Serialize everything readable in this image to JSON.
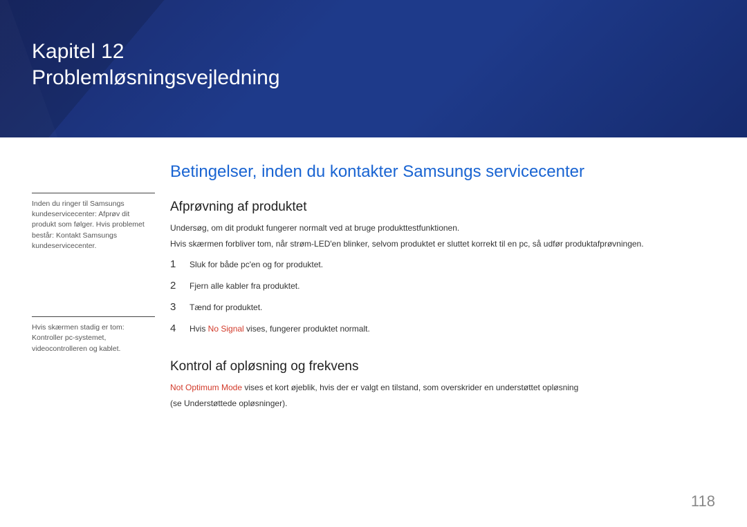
{
  "banner": {
    "chapter_label": "Kapitel 12",
    "chapter_title": "Problemløsningsvejledning"
  },
  "side_notes": [
    "Inden du ringer til Samsungs kundeservicecenter: Afprøv dit produkt som følger. Hvis problemet består: Kontakt Samsungs kundeservicecenter.",
    "Hvis skærmen stadig er tom: Kontroller pc-systemet, videocontrolleren og kablet."
  ],
  "main": {
    "section_title": "Betingelser, inden du kontakter Samsungs servicecenter",
    "sub1_title": "Afprøvning af produktet",
    "sub1_p1": "Undersøg, om dit produkt fungerer normalt ved at bruge produkttestfunktionen.",
    "sub1_p2": "Hvis skærmen forbliver tom, når strøm-LED'en blinker, selvom produktet er sluttet korrekt til en pc, så udfør produktafprøvningen.",
    "steps": [
      {
        "n": "1",
        "text": "Sluk for både pc'en og for produktet."
      },
      {
        "n": "2",
        "text": "Fjern alle kabler fra produktet."
      },
      {
        "n": "3",
        "text": "Tænd for produktet."
      },
      {
        "n": "4",
        "prefix": "Hvis ",
        "highlight": "No Signal",
        "suffix": " vises, fungerer produktet normalt."
      }
    ],
    "sub2_title": "Kontrol af opløsning og frekvens",
    "sub2_highlight": "Not Optimum Mode",
    "sub2_rest": " vises et kort øjeblik, hvis der er valgt en tilstand, som overskrider en understøttet opløsning",
    "sub2_p2": "(se Understøttede opløsninger)."
  },
  "page_number": "118"
}
